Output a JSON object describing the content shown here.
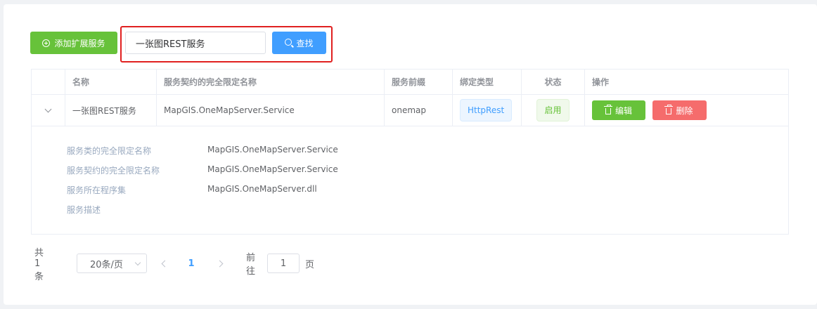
{
  "toolbar": {
    "add_label": "添加扩展服务",
    "search_value": "一张图REST服务",
    "search_label": "查找"
  },
  "table": {
    "columns": [
      "名称",
      "服务契约的完全限定名称",
      "服务前缀",
      "绑定类型",
      "状态",
      "操作"
    ],
    "rows": [
      {
        "name": "一张图REST服务",
        "contract": "MapGIS.OneMapServer.Service",
        "prefix": "onemap",
        "binding": "HttpRest",
        "status": "启用",
        "edit_label": "编辑",
        "delete_label": "删除"
      }
    ],
    "expanded": {
      "labels": [
        "服务类的完全限定名称",
        "服务契约的完全限定名称",
        "服务所在程序集",
        "服务描述"
      ],
      "values": [
        "MapGIS.OneMapServer.Service",
        "MapGIS.OneMapServer.Service",
        "MapGIS.OneMapServer.dll",
        ""
      ]
    }
  },
  "pagination": {
    "total_text": "共 1 条",
    "page_size": "20条/页",
    "current_page": "1",
    "goto_prefix": "前往",
    "goto_value": "1",
    "goto_suffix": "页"
  },
  "colors": {
    "success": "#67c23a",
    "primary": "#409eff",
    "danger": "#f56c6c",
    "highlight": "#e02020"
  }
}
